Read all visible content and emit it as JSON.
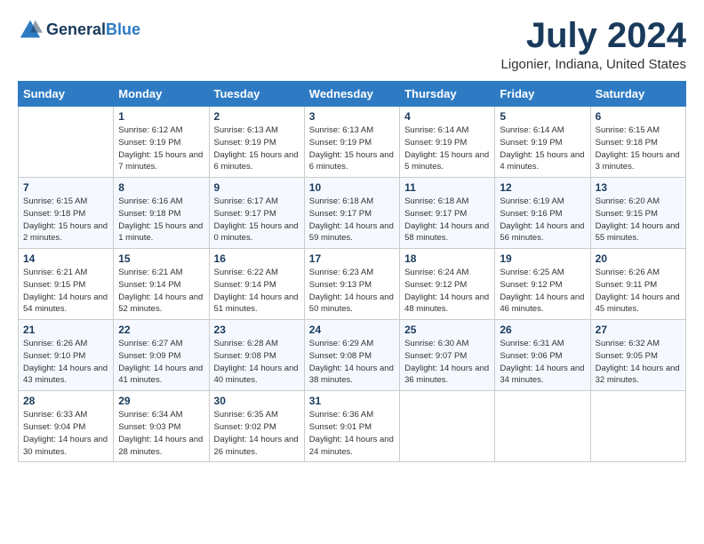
{
  "header": {
    "logo_line1": "General",
    "logo_line2": "Blue",
    "month": "July 2024",
    "location": "Ligonier, Indiana, United States"
  },
  "columns": [
    "Sunday",
    "Monday",
    "Tuesday",
    "Wednesday",
    "Thursday",
    "Friday",
    "Saturday"
  ],
  "weeks": [
    [
      {
        "day": "",
        "sunrise": "",
        "sunset": "",
        "daylight": ""
      },
      {
        "day": "1",
        "sunrise": "Sunrise: 6:12 AM",
        "sunset": "Sunset: 9:19 PM",
        "daylight": "Daylight: 15 hours and 7 minutes."
      },
      {
        "day": "2",
        "sunrise": "Sunrise: 6:13 AM",
        "sunset": "Sunset: 9:19 PM",
        "daylight": "Daylight: 15 hours and 6 minutes."
      },
      {
        "day": "3",
        "sunrise": "Sunrise: 6:13 AM",
        "sunset": "Sunset: 9:19 PM",
        "daylight": "Daylight: 15 hours and 6 minutes."
      },
      {
        "day": "4",
        "sunrise": "Sunrise: 6:14 AM",
        "sunset": "Sunset: 9:19 PM",
        "daylight": "Daylight: 15 hours and 5 minutes."
      },
      {
        "day": "5",
        "sunrise": "Sunrise: 6:14 AM",
        "sunset": "Sunset: 9:19 PM",
        "daylight": "Daylight: 15 hours and 4 minutes."
      },
      {
        "day": "6",
        "sunrise": "Sunrise: 6:15 AM",
        "sunset": "Sunset: 9:18 PM",
        "daylight": "Daylight: 15 hours and 3 minutes."
      }
    ],
    [
      {
        "day": "7",
        "sunrise": "Sunrise: 6:15 AM",
        "sunset": "Sunset: 9:18 PM",
        "daylight": "Daylight: 15 hours and 2 minutes."
      },
      {
        "day": "8",
        "sunrise": "Sunrise: 6:16 AM",
        "sunset": "Sunset: 9:18 PM",
        "daylight": "Daylight: 15 hours and 1 minute."
      },
      {
        "day": "9",
        "sunrise": "Sunrise: 6:17 AM",
        "sunset": "Sunset: 9:17 PM",
        "daylight": "Daylight: 15 hours and 0 minutes."
      },
      {
        "day": "10",
        "sunrise": "Sunrise: 6:18 AM",
        "sunset": "Sunset: 9:17 PM",
        "daylight": "Daylight: 14 hours and 59 minutes."
      },
      {
        "day": "11",
        "sunrise": "Sunrise: 6:18 AM",
        "sunset": "Sunset: 9:17 PM",
        "daylight": "Daylight: 14 hours and 58 minutes."
      },
      {
        "day": "12",
        "sunrise": "Sunrise: 6:19 AM",
        "sunset": "Sunset: 9:16 PM",
        "daylight": "Daylight: 14 hours and 56 minutes."
      },
      {
        "day": "13",
        "sunrise": "Sunrise: 6:20 AM",
        "sunset": "Sunset: 9:15 PM",
        "daylight": "Daylight: 14 hours and 55 minutes."
      }
    ],
    [
      {
        "day": "14",
        "sunrise": "Sunrise: 6:21 AM",
        "sunset": "Sunset: 9:15 PM",
        "daylight": "Daylight: 14 hours and 54 minutes."
      },
      {
        "day": "15",
        "sunrise": "Sunrise: 6:21 AM",
        "sunset": "Sunset: 9:14 PM",
        "daylight": "Daylight: 14 hours and 52 minutes."
      },
      {
        "day": "16",
        "sunrise": "Sunrise: 6:22 AM",
        "sunset": "Sunset: 9:14 PM",
        "daylight": "Daylight: 14 hours and 51 minutes."
      },
      {
        "day": "17",
        "sunrise": "Sunrise: 6:23 AM",
        "sunset": "Sunset: 9:13 PM",
        "daylight": "Daylight: 14 hours and 50 minutes."
      },
      {
        "day": "18",
        "sunrise": "Sunrise: 6:24 AM",
        "sunset": "Sunset: 9:12 PM",
        "daylight": "Daylight: 14 hours and 48 minutes."
      },
      {
        "day": "19",
        "sunrise": "Sunrise: 6:25 AM",
        "sunset": "Sunset: 9:12 PM",
        "daylight": "Daylight: 14 hours and 46 minutes."
      },
      {
        "day": "20",
        "sunrise": "Sunrise: 6:26 AM",
        "sunset": "Sunset: 9:11 PM",
        "daylight": "Daylight: 14 hours and 45 minutes."
      }
    ],
    [
      {
        "day": "21",
        "sunrise": "Sunrise: 6:26 AM",
        "sunset": "Sunset: 9:10 PM",
        "daylight": "Daylight: 14 hours and 43 minutes."
      },
      {
        "day": "22",
        "sunrise": "Sunrise: 6:27 AM",
        "sunset": "Sunset: 9:09 PM",
        "daylight": "Daylight: 14 hours and 41 minutes."
      },
      {
        "day": "23",
        "sunrise": "Sunrise: 6:28 AM",
        "sunset": "Sunset: 9:08 PM",
        "daylight": "Daylight: 14 hours and 40 minutes."
      },
      {
        "day": "24",
        "sunrise": "Sunrise: 6:29 AM",
        "sunset": "Sunset: 9:08 PM",
        "daylight": "Daylight: 14 hours and 38 minutes."
      },
      {
        "day": "25",
        "sunrise": "Sunrise: 6:30 AM",
        "sunset": "Sunset: 9:07 PM",
        "daylight": "Daylight: 14 hours and 36 minutes."
      },
      {
        "day": "26",
        "sunrise": "Sunrise: 6:31 AM",
        "sunset": "Sunset: 9:06 PM",
        "daylight": "Daylight: 14 hours and 34 minutes."
      },
      {
        "day": "27",
        "sunrise": "Sunrise: 6:32 AM",
        "sunset": "Sunset: 9:05 PM",
        "daylight": "Daylight: 14 hours and 32 minutes."
      }
    ],
    [
      {
        "day": "28",
        "sunrise": "Sunrise: 6:33 AM",
        "sunset": "Sunset: 9:04 PM",
        "daylight": "Daylight: 14 hours and 30 minutes."
      },
      {
        "day": "29",
        "sunrise": "Sunrise: 6:34 AM",
        "sunset": "Sunset: 9:03 PM",
        "daylight": "Daylight: 14 hours and 28 minutes."
      },
      {
        "day": "30",
        "sunrise": "Sunrise: 6:35 AM",
        "sunset": "Sunset: 9:02 PM",
        "daylight": "Daylight: 14 hours and 26 minutes."
      },
      {
        "day": "31",
        "sunrise": "Sunrise: 6:36 AM",
        "sunset": "Sunset: 9:01 PM",
        "daylight": "Daylight: 14 hours and 24 minutes."
      },
      {
        "day": "",
        "sunrise": "",
        "sunset": "",
        "daylight": ""
      },
      {
        "day": "",
        "sunrise": "",
        "sunset": "",
        "daylight": ""
      },
      {
        "day": "",
        "sunrise": "",
        "sunset": "",
        "daylight": ""
      }
    ]
  ]
}
